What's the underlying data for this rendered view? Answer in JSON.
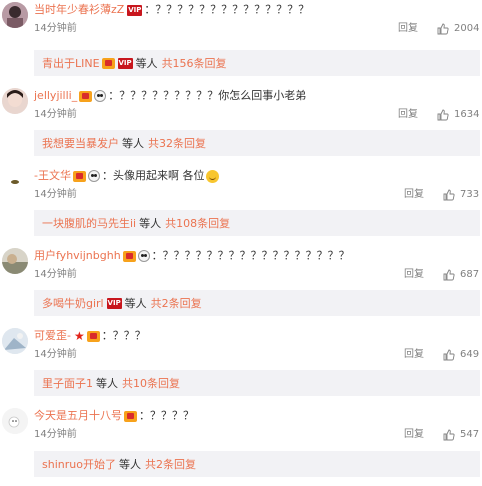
{
  "comments": [
    {
      "user": "当时年少春衫薄zZ",
      "badges": [
        "vip"
      ],
      "text": "？？？？？？？？？？？？？？",
      "time": "14分钟前",
      "reply_label": "回复",
      "likes": "2004",
      "thread": {
        "user": "青出于LINE",
        "badges": [
          "crown",
          "vip"
        ],
        "people": "等人",
        "total": "共156条回复"
      }
    },
    {
      "user": "jellyjilli_",
      "badges": [
        "crown",
        "face"
      ],
      "text": "？？？？？？？？？你怎么回事小老弟",
      "time": "14分钟前",
      "reply_label": "回复",
      "likes": "1634",
      "thread": {
        "user": "我想要当暴发户",
        "badges": [],
        "people": "等人",
        "total": "共32条回复"
      }
    },
    {
      "user": "-王文华",
      "badges": [
        "crown",
        "face"
      ],
      "text": "头像用起来啊 各位",
      "time": "14分钟前",
      "reply_label": "回复",
      "likes": "733",
      "thread": {
        "user": "一块腹肌的马先生ii",
        "badges": [],
        "people": "等人",
        "total": "共108条回复"
      }
    },
    {
      "user": "用户fyhvijnbghh",
      "badges": [
        "crown",
        "face"
      ],
      "text": "？？？？？？？？？？？？？？？？？",
      "time": "14分钟前",
      "reply_label": "回复",
      "likes": "687",
      "thread": {
        "user": "多喝牛奶girl",
        "badges": [
          "vip"
        ],
        "people": "等人",
        "total": "共2条回复"
      }
    },
    {
      "user": "可爱歪-",
      "badges": [
        "star",
        "crown"
      ],
      "text": "？？？",
      "time": "14分钟前",
      "reply_label": "回复",
      "likes": "649",
      "thread": {
        "user": "里子面子1",
        "badges": [],
        "people": "等人",
        "total": "共10条回复"
      }
    },
    {
      "user": "今天是五月十八号",
      "badges": [
        "crown"
      ],
      "text": "？？？？",
      "time": "14分钟前",
      "reply_label": "回复",
      "likes": "547",
      "thread": {
        "user": "shinruo开始了",
        "badges": [],
        "people": "等人",
        "total": "共2条回复"
      }
    }
  ],
  "colors": {
    "link": "#eb7350",
    "muted": "#808080",
    "sub_bg": "#f2f2f5"
  },
  "icons": {
    "like": "thumbs-up-icon",
    "avatar": "avatar"
  }
}
